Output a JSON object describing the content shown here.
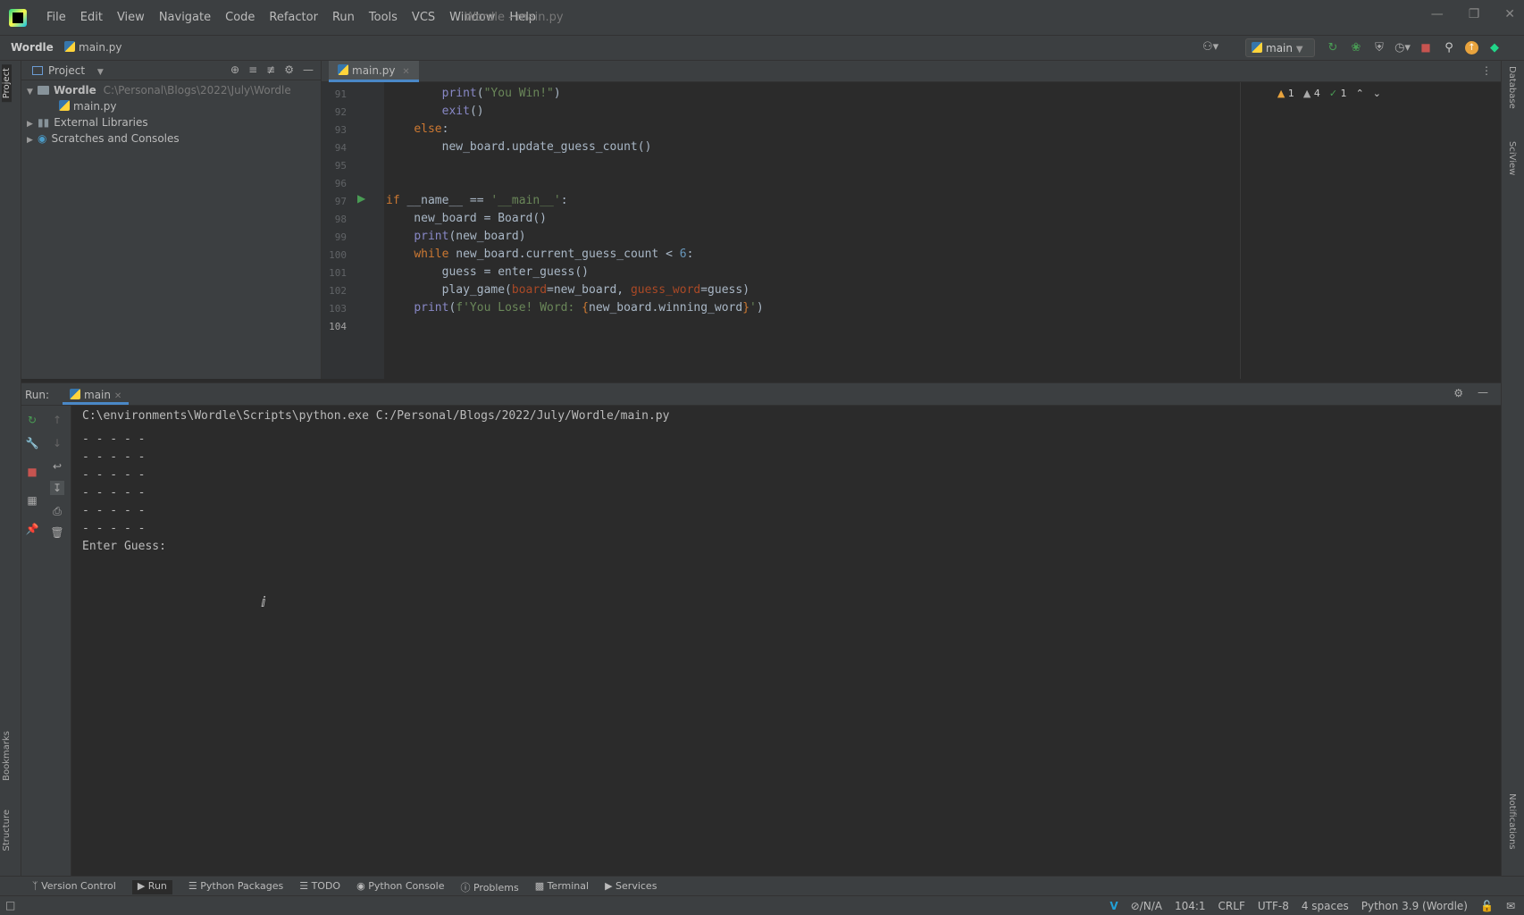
{
  "window": {
    "title": "Wordle - main.py",
    "menus": [
      "File",
      "Edit",
      "View",
      "Navigate",
      "Code",
      "Refactor",
      "Run",
      "Tools",
      "VCS",
      "Window",
      "Help"
    ]
  },
  "navbar": {
    "project": "Wordle",
    "file": "main.py",
    "run_config": "main"
  },
  "left_stripe": {
    "project_tab": "Project",
    "bookmarks_tab": "Bookmarks",
    "structure_tab": "Structure"
  },
  "right_stripe": {
    "database_tab": "Database",
    "sciview_tab": "SciView",
    "notifications_tab": "Notifications"
  },
  "project_panel": {
    "title": "Project",
    "root_name": "Wordle",
    "root_path": "C:\\Personal\\Blogs\\2022\\July\\Wordle",
    "file": "main.py",
    "external": "External Libraries",
    "scratches": "Scratches and Consoles"
  },
  "editor": {
    "tab": "main.py",
    "inspections": {
      "warn1": "1",
      "warn2": "4",
      "ok": "1"
    },
    "line_numbers": [
      "91",
      "92",
      "93",
      "94",
      "95",
      "96",
      "97",
      "98",
      "99",
      "100",
      "101",
      "102",
      "103",
      "104"
    ]
  },
  "run_panel": {
    "label": "Run:",
    "tab": "main",
    "command": "C:\\environments\\Wordle\\Scripts\\python.exe C:/Personal/Blogs/2022/July/Wordle/main.py",
    "board_rows": [
      "- - - - -",
      "- - - - -",
      "- - - - -",
      "- - - - -",
      "- - - - -",
      "- - - - -"
    ],
    "prompt": "Enter Guess:"
  },
  "toolwindows": [
    "Version Control",
    "Run",
    "Python Packages",
    "TODO",
    "Python Console",
    "Problems",
    "Terminal",
    "Services"
  ],
  "status_bar": {
    "vcs": "⊘/N/A",
    "position": "104:1",
    "line_sep": "CRLF",
    "encoding": "UTF-8",
    "indent": "4 spaces",
    "interpreter": "Python 3.9 (Wordle)"
  }
}
